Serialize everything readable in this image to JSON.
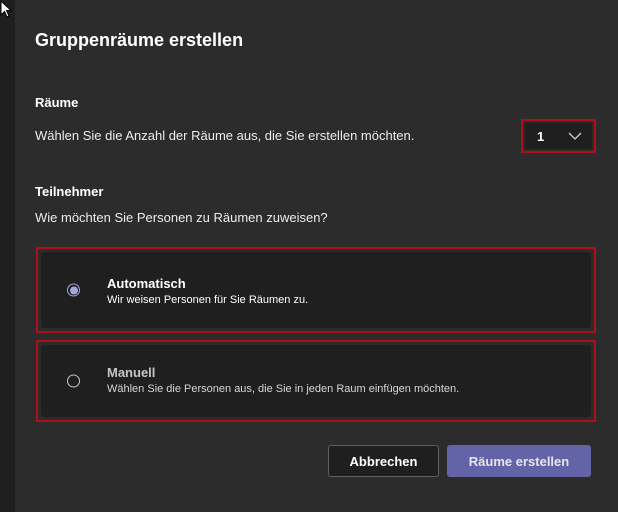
{
  "dialog": {
    "title": "Gruppenräume erstellen"
  },
  "rooms": {
    "label": "Räume",
    "description": "Wählen Sie die Anzahl der Räume aus, die Sie erstellen möchten.",
    "selected_value": "1"
  },
  "participants": {
    "label": "Teilnehmer",
    "question": "Wie möchten Sie Personen zu Räumen zuweisen?",
    "options": [
      {
        "title": "Automatisch",
        "subtitle": "Wir weisen Personen für Sie Räumen zu.",
        "selected": true
      },
      {
        "title": "Manuell",
        "subtitle": "Wählen Sie die Personen aus, die Sie in jeden Raum einfügen möchten.",
        "selected": false
      }
    ]
  },
  "buttons": {
    "cancel": "Abbrechen",
    "create": "Räume erstellen"
  },
  "colors": {
    "dialog_bg": "#2d2c2c",
    "field_bg": "#201f1f",
    "accent": "#6264a7",
    "highlight_border": "#b00e1b",
    "radio_checked": "#a6a7dc"
  },
  "icons": {
    "rooms_select": "chevron-down-icon",
    "cursor": "mouse-pointer-icon"
  }
}
